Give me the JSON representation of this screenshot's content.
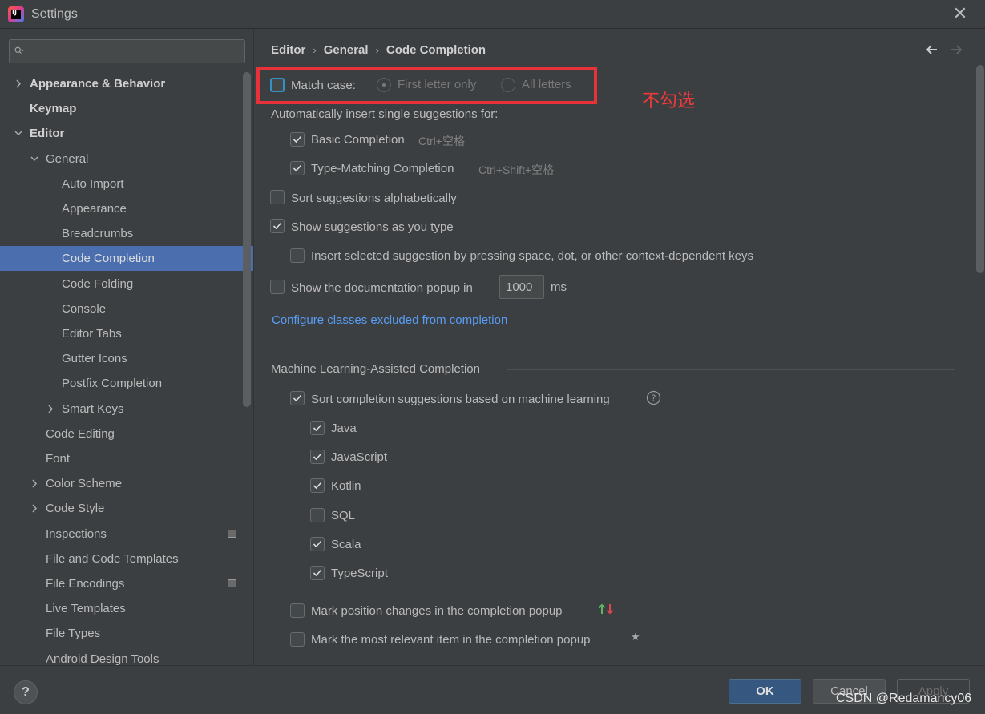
{
  "window": {
    "title": "Settings"
  },
  "search": {
    "placeholder": ""
  },
  "sidebar": {
    "items": [
      {
        "label": "Appearance & Behavior",
        "arrow": "right"
      },
      {
        "label": "Keymap"
      },
      {
        "label": "Editor",
        "arrow": "down"
      },
      {
        "label": "General",
        "arrow": "down"
      },
      {
        "label": "Auto Import"
      },
      {
        "label": "Appearance"
      },
      {
        "label": "Breadcrumbs"
      },
      {
        "label": "Code Completion",
        "selected": true
      },
      {
        "label": "Code Folding"
      },
      {
        "label": "Console"
      },
      {
        "label": "Editor Tabs"
      },
      {
        "label": "Gutter Icons"
      },
      {
        "label": "Postfix Completion"
      },
      {
        "label": "Smart Keys",
        "arrow": "right"
      },
      {
        "label": "Code Editing"
      },
      {
        "label": "Font"
      },
      {
        "label": "Color Scheme",
        "arrow": "right"
      },
      {
        "label": "Code Style",
        "arrow": "right"
      },
      {
        "label": "Inspections",
        "project_icon": true
      },
      {
        "label": "File and Code Templates"
      },
      {
        "label": "File Encodings",
        "project_icon": true
      },
      {
        "label": "Live Templates"
      },
      {
        "label": "File Types"
      },
      {
        "label": "Android Design Tools"
      }
    ]
  },
  "breadcrumb": {
    "items": [
      "Editor",
      "General",
      "Code Completion"
    ],
    "separator": "›"
  },
  "content": {
    "match_case": {
      "label": "Match case:",
      "checked": false
    },
    "first_letter_only": {
      "label": "First letter only",
      "selected": true
    },
    "all_letters": {
      "label": "All letters",
      "selected": false
    },
    "annotation": "不勾选",
    "auto_insert_heading": "Automatically insert single suggestions for:",
    "basic_completion": {
      "label": "Basic Completion",
      "shortcut": "Ctrl+空格",
      "checked": true
    },
    "type_matching": {
      "label": "Type-Matching Completion",
      "shortcut": "Ctrl+Shift+空格",
      "checked": true
    },
    "sort_alpha": {
      "label": "Sort suggestions alphabetically",
      "checked": false
    },
    "show_as_type": {
      "label": "Show suggestions as you type",
      "checked": true
    },
    "insert_selected": {
      "label": "Insert selected suggestion by pressing space, dot, or other context-dependent keys",
      "checked": false
    },
    "doc_popup": {
      "label": "Show the documentation popup in",
      "value": "1000",
      "unit": "ms",
      "checked": false
    },
    "configure_link": "Configure classes excluded from completion",
    "ml_heading": "Machine Learning-Assisted Completion",
    "ml_sort": {
      "label": "Sort completion suggestions based on machine learning",
      "checked": true
    },
    "languages": [
      {
        "label": "Java",
        "checked": true
      },
      {
        "label": "JavaScript",
        "checked": true
      },
      {
        "label": "Kotlin",
        "checked": true
      },
      {
        "label": "SQL",
        "checked": false
      },
      {
        "label": "Scala",
        "checked": true
      },
      {
        "label": "TypeScript",
        "checked": true
      }
    ],
    "mark_position": {
      "label": "Mark position changes in the completion popup",
      "checked": false
    },
    "mark_relevant": {
      "label": "Mark the most relevant item in the completion popup",
      "checked": false
    }
  },
  "footer": {
    "help": "?",
    "ok": "OK",
    "cancel": "Cancel",
    "apply": "Apply",
    "watermark": "CSDN @Redamancy06"
  }
}
